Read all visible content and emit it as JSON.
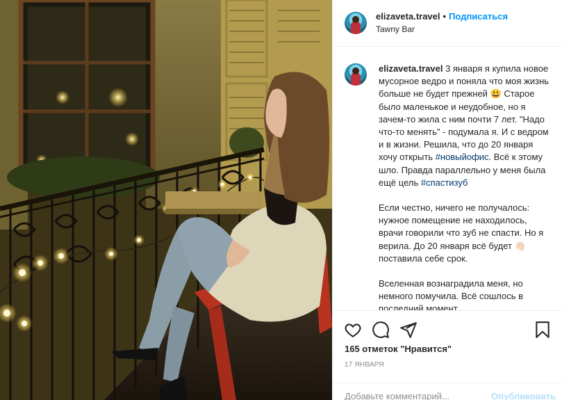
{
  "post": {
    "username": "elizaveta.travel",
    "separator": "•",
    "follow_label": "Подписаться",
    "location": "Tawny Bar"
  },
  "caption": {
    "username": "elizaveta.travel",
    "p1_text1": " 3 января я купила новое мусорное ведро и поняла что моя жизнь больше не будет прежней 😃 Старое было маленькое и неудобное, но я зачем-то жила с ним почти 7 лет. \"Надо что-то менять\" - подумала я. И с ведром и в жизни. Решила, что до 20 января хочу открыть ",
    "p1_tag1": "#новыйофис",
    "p1_text2": ". Всё к этому шло. Правда параллельно у меня была ещё цель ",
    "p1_tag2": "#спастизуб",
    "p2": "Если честно, ничего не получалось: нужное помещение не находилось, врачи говорили что зуб не спасти. Но я верила. До 20 января всё будет 👋🏻 поставила себе срок.",
    "p3": "Вселенная вознаградила меня, но немного помучила. Всё сошлось в последний момент."
  },
  "icons": {
    "like": "heart-icon",
    "comment": "comment-icon",
    "share": "share-icon",
    "save": "bookmark-icon"
  },
  "likes_text": "165 отметок \"Нравится\"",
  "date_text": "17 ЯНВАРЯ",
  "comment": {
    "placeholder": "Добавьте комментарий...",
    "post_label": "Опубликовать"
  },
  "colors": {
    "accent": "#0095f6",
    "post_disabled": "#b2dffc",
    "tag": "#00376b",
    "muted": "#8e8e8e"
  }
}
